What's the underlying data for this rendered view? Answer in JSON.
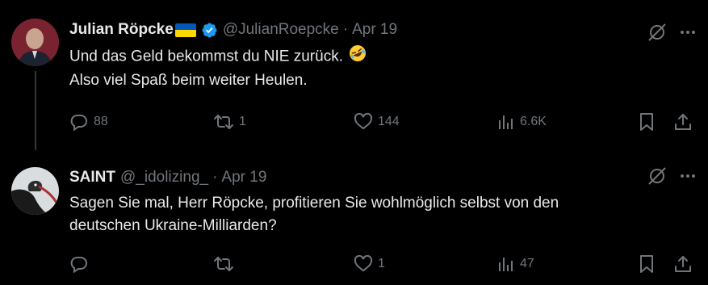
{
  "tweets": [
    {
      "name": "Julian Röpcke",
      "handle": "@JulianRoepcke",
      "separator": "·",
      "date": "Apr 19",
      "lines": [
        "Und das Geld bekommst du NIE zurück.",
        "Also viel Spaß beim weiter Heulen."
      ],
      "stats": {
        "replies": "88",
        "reposts": "1",
        "likes": "144",
        "views": "6.6K"
      },
      "flag_colors": [
        "#0057b7",
        "#ffd700"
      ],
      "verified_color": "#1d9bf0",
      "emoji": "rolling-on-floor-laughing"
    },
    {
      "name": "SAINT",
      "handle": "@_idolizing_",
      "separator": "·",
      "date": "Apr 19",
      "lines": [
        "Sagen Sie mal, Herr Röpcke, profitieren Sie wohlmöglich selbst von den",
        "deutschen Ukraine-Milliarden?"
      ],
      "stats": {
        "replies": "",
        "reposts": "",
        "likes": "1",
        "views": "47"
      }
    }
  ],
  "icons": [
    "grok-icon",
    "more-icon",
    "reply-icon",
    "repost-icon",
    "like-icon",
    "views-icon",
    "bookmark-icon",
    "share-icon"
  ]
}
